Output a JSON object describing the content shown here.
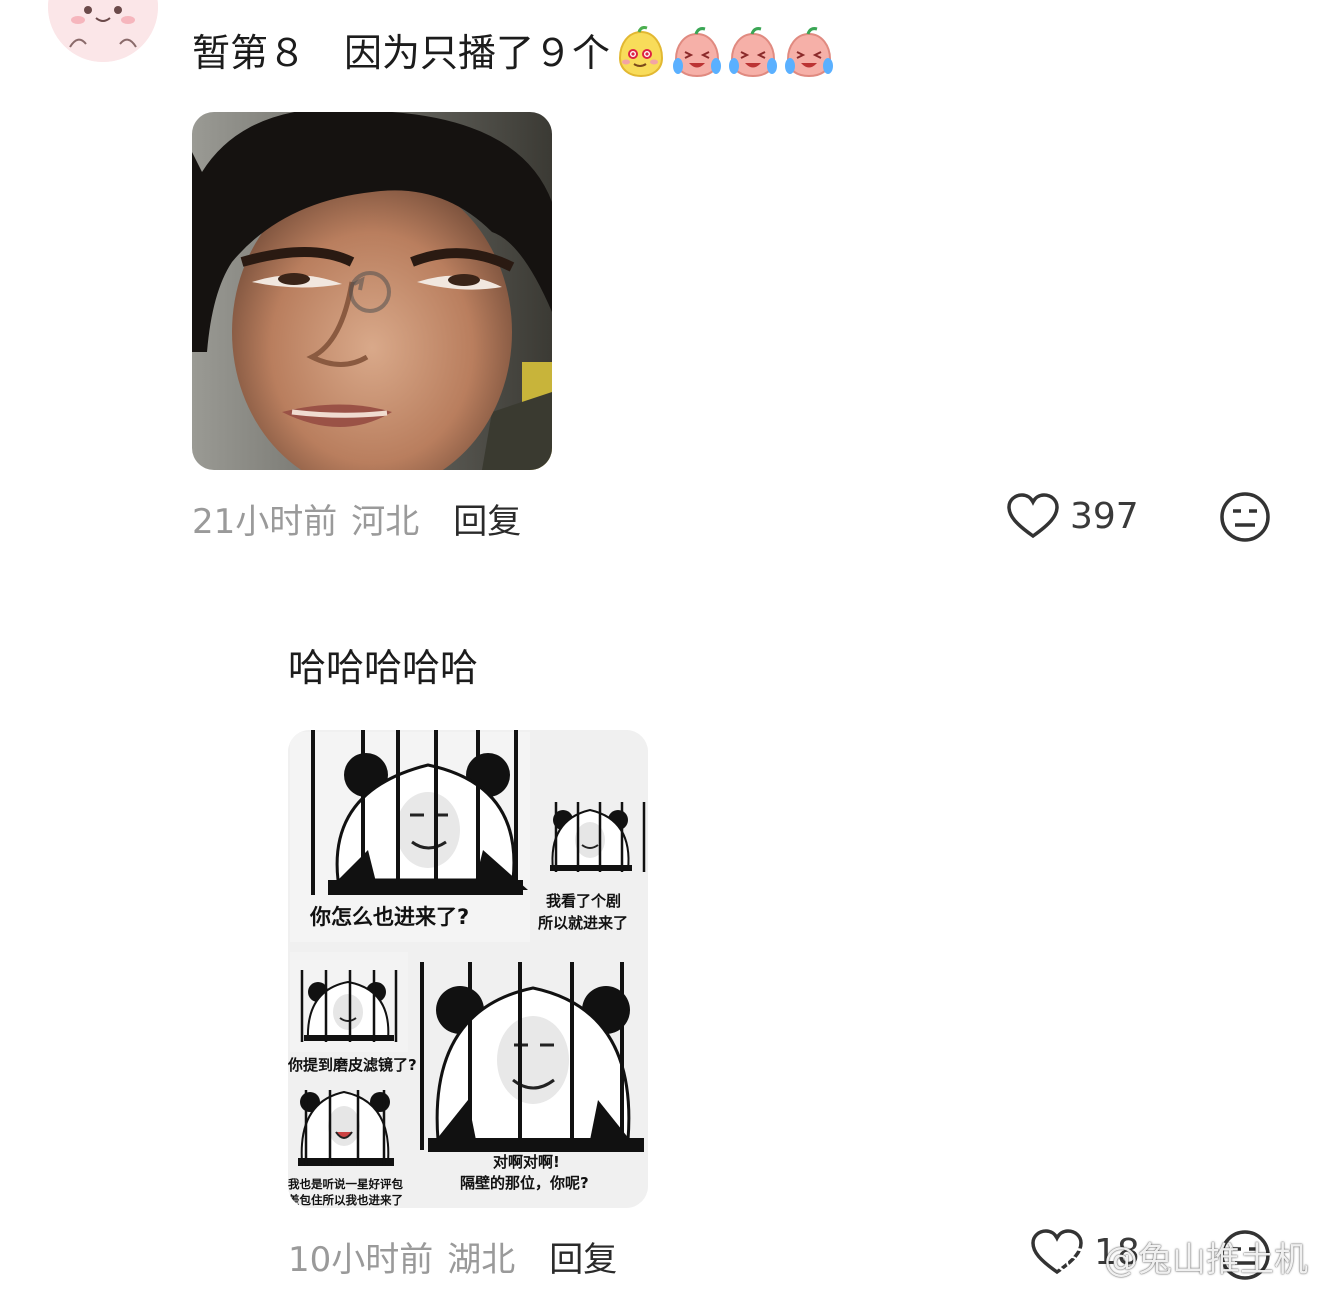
{
  "comments": [
    {
      "text": "暂第８　因为只播了９个",
      "emojis": [
        "smug-bean-emoji",
        "crying-bean-emoji",
        "crying-bean-emoji",
        "crying-bean-emoji"
      ],
      "time": "21小时前",
      "location": "河北",
      "reply_label": "回复",
      "likes": "397"
    },
    {
      "text": "哈哈哈哈哈",
      "time": "10小时前",
      "location": "湖北",
      "reply_label": "回复",
      "likes": "18",
      "meme_captions": {
        "panel1": "你怎么也进来了?",
        "panel2_line1": "我看了个剧",
        "panel2_line2": "所以就进来了",
        "panel3": "你提到磨皮滤镜了?",
        "panel4_line1": "我也是听说一星好评包",
        "panel4_line2": "差包住所以我也进来了",
        "panel5_line1": "对啊对啊!",
        "panel5_line2": "隔壁的那位，你呢?"
      }
    }
  ],
  "watermark": "@兔山推土机",
  "colors": {
    "meta_gray": "#9a9a9a",
    "text": "#1c1c1c",
    "avatar_bg": "#fbe6e8"
  }
}
